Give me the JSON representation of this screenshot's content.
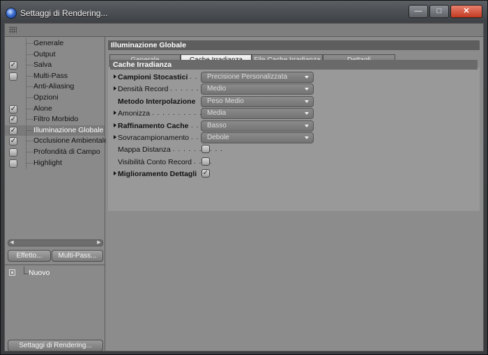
{
  "window": {
    "title": "Settaggi di Rendering...",
    "minimize_icon": "—",
    "maximize_icon": "□",
    "close_icon": "✕"
  },
  "sidebar": {
    "items": [
      {
        "label": "Generale",
        "checkbox": false
      },
      {
        "label": "Output",
        "checkbox": false
      },
      {
        "label": "Salva",
        "checkbox": true,
        "checked": true
      },
      {
        "label": "Multi-Pass",
        "checkbox": true,
        "checked": false
      },
      {
        "label": "Anti-Aliasing",
        "checkbox": false
      },
      {
        "label": "Opzioni",
        "checkbox": false
      },
      {
        "label": "Alone",
        "checkbox": true,
        "checked": true
      },
      {
        "label": "Filtro Morbido",
        "checkbox": true,
        "checked": true
      },
      {
        "label": "Illuminazione Globale",
        "checkbox": true,
        "checked": true,
        "selected": true
      },
      {
        "label": "Occlusione Ambientale",
        "checkbox": true,
        "checked": true
      },
      {
        "label": "Profondità di Campo",
        "checkbox": true,
        "checked": false
      },
      {
        "label": "Highlight",
        "checkbox": true,
        "checked": false
      }
    ],
    "effetto_button": "Effetto...",
    "multipass_button": "Multi-Pass...",
    "preset_item": "Nuovo",
    "render_settings_button": "Settaggi di Rendering..."
  },
  "main": {
    "section_title": "Illuminazione Globale",
    "tabs": [
      {
        "label": "Generale",
        "active": false
      },
      {
        "label": "Cache Irradianza",
        "active": true
      },
      {
        "label": "File Cache Irradianza",
        "active": false
      },
      {
        "label": "Dettagli",
        "active": false
      }
    ],
    "subsection_title": "Cache Irradianza",
    "params": [
      {
        "label": "Campioni Stocastici",
        "bold": true,
        "marker": true,
        "dots": ". . .",
        "type": "dropdown",
        "value": "Precisione Personalizzata"
      },
      {
        "label": "Densità Record",
        "bold": false,
        "marker": true,
        "dots": ". . . . . . . .",
        "type": "dropdown",
        "value": "Medio"
      },
      {
        "label": "Metodo Interpolazione",
        "bold": true,
        "marker": false,
        "dots": "",
        "type": "dropdown",
        "value": "Peso Medio"
      },
      {
        "label": "Amonizza",
        "bold": false,
        "marker": true,
        "dots": ". . . . . . . . . . . . . . .",
        "type": "dropdown",
        "value": "Media"
      },
      {
        "label": "Raffinamento Cache",
        "bold": true,
        "marker": true,
        "dots": ". .",
        "type": "dropdown",
        "value": "Basso"
      },
      {
        "label": "Sovracampionamento",
        "bold": false,
        "marker": true,
        "dots": ". . . .",
        "type": "dropdown",
        "value": "Debole"
      },
      {
        "label": "Mappa Distanza",
        "bold": false,
        "marker": false,
        "dots": ". . . . . . . . . .",
        "type": "checkbox",
        "checked": false
      },
      {
        "label": "Visibilità Conto Record",
        "bold": false,
        "marker": false,
        "dots": ". . . .",
        "type": "checkbox",
        "checked": false
      },
      {
        "label": "Miglioramento Dettagli",
        "bold": true,
        "marker": true,
        "dots": "",
        "type": "checkbox",
        "checked": true
      }
    ]
  },
  "glyphs": {
    "check": "✓",
    "scroll_left": "◀",
    "scroll_right": "▶"
  }
}
